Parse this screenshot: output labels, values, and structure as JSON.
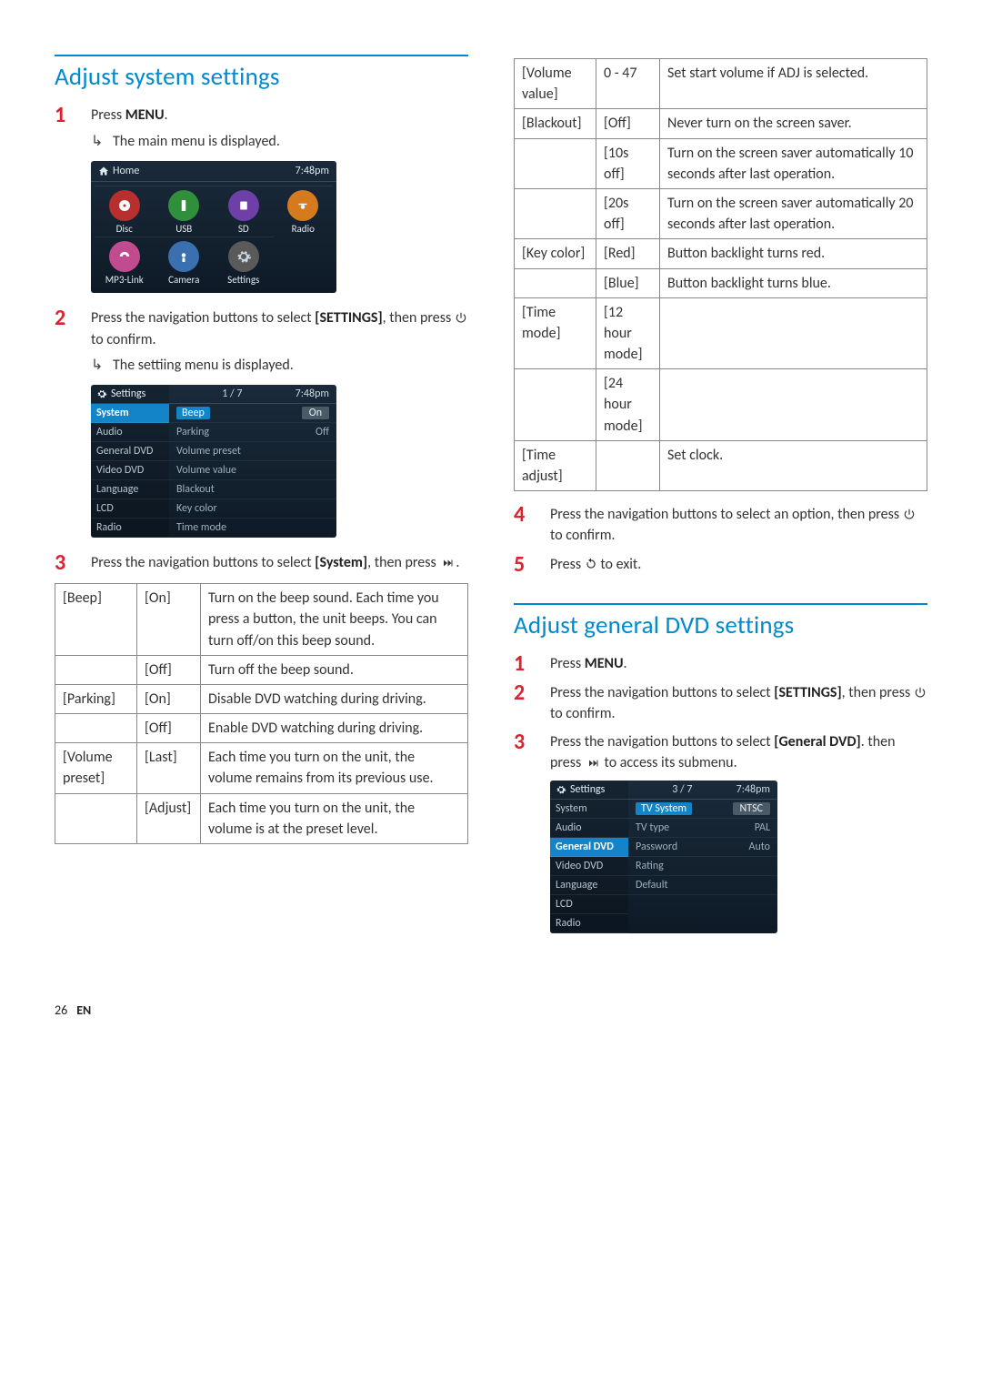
{
  "section1_title": "Adjust system settings",
  "section2_title": "Adjust general DVD settings",
  "steps_a": {
    "s1": {
      "num": "1",
      "text_a": "Press ",
      "bold": "MENU",
      "text_b": "."
    },
    "s1_sub": "The main menu is displayed.",
    "s2": {
      "num": "2",
      "text_a": "Press the navigation buttons to select ",
      "bold": "[SETTINGS]",
      "text_b": ", then press ",
      "text_c": " to confirm."
    },
    "s2_sub": "The settiing menu is displayed.",
    "s3": {
      "num": "3",
      "text_a": "Press the navigation buttons to select ",
      "bold": "[System]",
      "text_b": ", then press ",
      "icon": "▶▶I",
      "text_c": "."
    },
    "s4": {
      "num": "4",
      "text_a": "Press the navigation buttons to select an option, then press ",
      "text_b": "to confirm."
    },
    "s5": {
      "num": "5",
      "text_a": "Press ",
      "text_b": " to exit."
    }
  },
  "steps_b": {
    "s1": {
      "num": "1",
      "text_a": "Press ",
      "bold": "MENU",
      "text_b": "."
    },
    "s2": {
      "num": "2",
      "text_a": "Press the navigation buttons to select ",
      "bold": "[SETTINGS]",
      "text_b": ", then press ",
      "text_c": " to confirm."
    },
    "s3": {
      "num": "3",
      "text_a": "Press the navigation buttons to select ",
      "bold": "[General DVD]",
      "text_b": ". then press ",
      "text_c": " to access its submenu."
    }
  },
  "device_home": {
    "title": "Home",
    "time": "7:48pm",
    "items": [
      "Disc",
      "USB",
      "SD",
      "Radio",
      "MP3-Link",
      "Camera",
      "Settings"
    ]
  },
  "device_settings1": {
    "header": "Settings",
    "page": "1 / 7",
    "time": "7:48pm",
    "side": [
      "System",
      "Audio",
      "General DVD",
      "Video DVD",
      "Language",
      "LCD",
      "Radio"
    ],
    "active_side": "System",
    "rows": [
      {
        "k": "Beep",
        "v": "On",
        "sel": true
      },
      {
        "k": "Parking",
        "v": "Off"
      },
      {
        "k": "Volume preset",
        "v": ""
      },
      {
        "k": "Volume value",
        "v": ""
      },
      {
        "k": "Blackout",
        "v": ""
      },
      {
        "k": "Key color",
        "v": ""
      },
      {
        "k": "Time mode",
        "v": ""
      }
    ]
  },
  "device_settings2": {
    "header": "Settings",
    "page": "3 / 7",
    "time": "7:48pm",
    "side": [
      "System",
      "Audio",
      "General DVD",
      "Video DVD",
      "Language",
      "LCD",
      "Radio"
    ],
    "active_side": "General DVD",
    "rows": [
      {
        "k": "TV System",
        "v": "NTSC",
        "sel": true
      },
      {
        "k": "TV type",
        "v": "PAL"
      },
      {
        "k": "Password",
        "v": "Auto"
      },
      {
        "k": "Rating",
        "v": ""
      },
      {
        "k": "Default",
        "v": ""
      }
    ]
  },
  "table_left": [
    {
      "c0": "[Beep]",
      "c1": "[On]",
      "c2": "Turn on the beep sound. Each time you press a button, the unit beeps. You can turn off/on this beep sound."
    },
    {
      "c0": "",
      "c1": "[Off]",
      "c2": "Turn off the beep sound."
    },
    {
      "c0": "[Parking]",
      "c1": "[On]",
      "c2": "Disable DVD watching during driving."
    },
    {
      "c0": "",
      "c1": "[Off]",
      "c2": "Enable DVD watching during driving."
    },
    {
      "c0": "[Volume preset]",
      "c1": "[Last]",
      "c2": "Each time you turn on the unit, the volume remains from its previous use."
    },
    {
      "c0": "",
      "c1": "[Adjust]",
      "c2": "Each time you turn on the unit, the volume is at the preset level."
    }
  ],
  "table_right": [
    {
      "c0": "[Volume value]",
      "c1": "0 - 47",
      "c2": "Set start volume if ADJ is selected."
    },
    {
      "c0": "[Blackout]",
      "c1": "[Off]",
      "c2": "Never turn on the screen saver."
    },
    {
      "c0": "",
      "c1": "[10s off]",
      "c2": "Turn on the screen saver automatically 10 seconds after last operation."
    },
    {
      "c0": "",
      "c1": "[20s off]",
      "c2": "Turn on the screen saver automatically 20 seconds after last operation."
    },
    {
      "c0": "[Key color]",
      "c1": "[Red]",
      "c2": "Button backlight turns red."
    },
    {
      "c0": "",
      "c1": "[Blue]",
      "c2": "Button backlight turns blue."
    },
    {
      "c0": "[Time mode]",
      "c1": "[12 hour mode]",
      "c2": ""
    },
    {
      "c0": "",
      "c1": "[24 hour mode]",
      "c2": ""
    },
    {
      "c0": "[Time adjust]",
      "c1": "",
      "c2": "Set clock."
    }
  ],
  "footer": {
    "page": "26",
    "lang": "EN"
  }
}
